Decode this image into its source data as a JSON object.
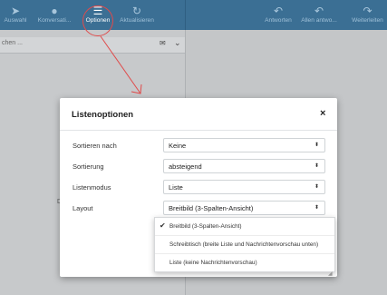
{
  "toolbar": {
    "buttons": [
      {
        "label": "Auswahl",
        "icon": "cursor-icon"
      },
      {
        "label": "Konversati...",
        "icon": "chat-icon"
      },
      {
        "label": "Optionen",
        "icon": "hamburger-icon"
      },
      {
        "label": "Aktualisieren",
        "icon": "refresh-icon"
      },
      {
        "label": "Antworten",
        "icon": "reply-icon"
      },
      {
        "label": "Allen antwo...",
        "icon": "reply-all-icon"
      },
      {
        "label": "Weiterleiten",
        "icon": "forward-icon"
      }
    ]
  },
  "search": {
    "placeholder": "chen ..."
  },
  "background_text": "Di",
  "modal": {
    "title": "Listenoptionen",
    "close": "×",
    "rows": [
      {
        "label": "Sortieren nach",
        "value": "Keine"
      },
      {
        "label": "Sortierung",
        "value": "absteigend"
      },
      {
        "label": "Listenmodus",
        "value": "Liste"
      },
      {
        "label": "Layout",
        "value": "Breitbild (3-Spalten-Ansicht)"
      }
    ]
  },
  "layout_dropdown": {
    "options": [
      {
        "label": "Breitbild (3-Spalten-Ansicht)",
        "selected": true
      },
      {
        "label": "Schreibtisch (breite Liste und Nachrichtenvorschau unten)",
        "selected": false
      },
      {
        "label": "Liste (keine Nachrichtenvorschau)",
        "selected": false
      }
    ]
  },
  "colors": {
    "toolbar": "#3b6f94",
    "annotation": "#e04a4a"
  }
}
